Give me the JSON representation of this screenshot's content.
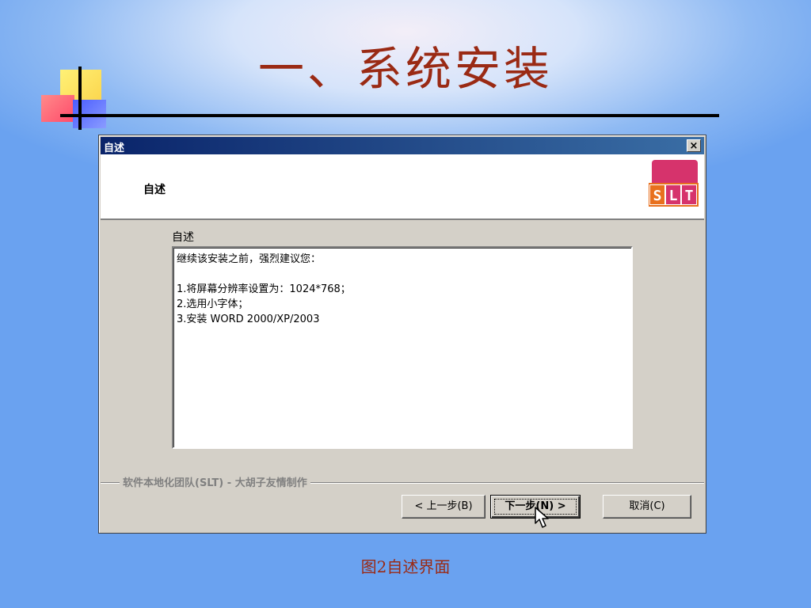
{
  "slide": {
    "title": "一、系统安装",
    "caption": "图2自述界面"
  },
  "dialog": {
    "window_title": "自述",
    "close_label": "×",
    "header_title": "自述",
    "logo_text": "SLT",
    "section_label": "自述",
    "readme_lines": [
      "继续该安装之前，强烈建议您：",
      "",
      "1.将屏幕分辨率设置为：1024*768；",
      "2.选用小字体；",
      "3.安装 WORD 2000/XP/2003"
    ],
    "brand_text": "软件本地化团队(SLT) - 大胡子友情制作",
    "buttons": {
      "back": "< 上一步(B)",
      "next": "下一步(N) >",
      "cancel": "取消(C)"
    }
  },
  "colors": {
    "title_color": "#9a2a14",
    "titlebar_start": "#0a246a",
    "titlebar_end": "#3a6ea5",
    "dialog_face": "#d4d0c8",
    "logo_pink": "#d6336c",
    "logo_orange": "#e8701e"
  }
}
